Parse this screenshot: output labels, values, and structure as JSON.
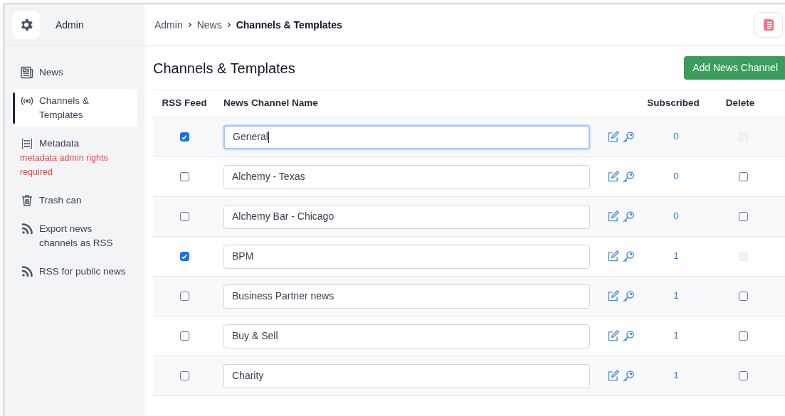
{
  "app": {
    "title": "Admin"
  },
  "sidebar": {
    "items": [
      {
        "kind": "news",
        "text": "News",
        "selected": false
      },
      {
        "kind": "broadcast",
        "text": "Channels & Templates",
        "selected": true
      },
      {
        "kind": "grid",
        "text": "Metadata",
        "warning": "metadata admin rights required",
        "selected": false
      },
      {
        "kind": "trash",
        "text": "Trash can",
        "selected": false
      },
      {
        "kind": "rss",
        "text": "Export news channels as RSS",
        "selected": false
      },
      {
        "kind": "rss",
        "text": "RSS for public news",
        "selected": false
      }
    ]
  },
  "breadcrumb": [
    "Admin",
    "News",
    "Channels & Templates"
  ],
  "page": {
    "title": "Channels & Templates",
    "add_button": "Add News Channel"
  },
  "table": {
    "columns": [
      "RSS Feed",
      "News Channel Name",
      "Subscribed",
      "Delete"
    ],
    "rows": [
      {
        "rss": true,
        "name": "General",
        "focused": true,
        "subscribed": "0",
        "delete_disabled": true
      },
      {
        "rss": false,
        "name": "Alchemy - Texas",
        "focused": false,
        "subscribed": "0",
        "delete_disabled": false
      },
      {
        "rss": false,
        "name": "Alchemy Bar - Chicago",
        "focused": false,
        "subscribed": "0",
        "delete_disabled": false
      },
      {
        "rss": true,
        "name": "BPM",
        "focused": false,
        "subscribed": "1",
        "delete_disabled": true
      },
      {
        "rss": false,
        "name": "Business Partner news",
        "focused": false,
        "subscribed": "1",
        "delete_disabled": false
      },
      {
        "rss": false,
        "name": "Buy & Sell",
        "focused": false,
        "subscribed": "1",
        "delete_disabled": false
      },
      {
        "rss": false,
        "name": "Charity",
        "focused": false,
        "subscribed": "1",
        "delete_disabled": false
      }
    ]
  }
}
